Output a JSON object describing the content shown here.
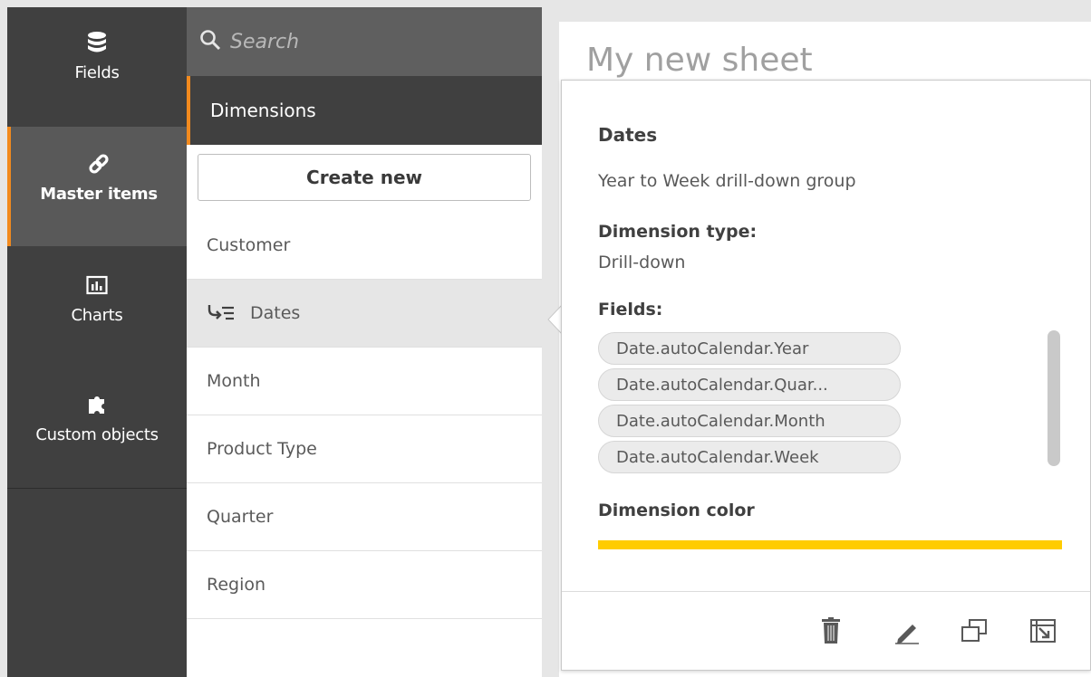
{
  "nav": {
    "items": [
      {
        "label": "Fields",
        "icon": "database-icon"
      },
      {
        "label": "Master items",
        "icon": "link-icon"
      },
      {
        "label": "Charts",
        "icon": "bar-chart-icon"
      },
      {
        "label": "Custom objects",
        "icon": "puzzle-icon"
      }
    ]
  },
  "search": {
    "placeholder": "Search"
  },
  "section": {
    "title": "Dimensions"
  },
  "create_button": "Create new",
  "dimensions": [
    {
      "label": "Customer"
    },
    {
      "label": "Dates",
      "drilldown": true,
      "selected": true
    },
    {
      "label": "Month"
    },
    {
      "label": "Product Type"
    },
    {
      "label": "Quarter"
    },
    {
      "label": "Region"
    }
  ],
  "sheet": {
    "title": "My new sheet"
  },
  "popover": {
    "title": "Dates",
    "description": "Year to Week drill-down group",
    "type_label": "Dimension type:",
    "type_value": "Drill-down",
    "fields_label": "Fields:",
    "fields": [
      "Date.autoCalendar.Year",
      "Date.autoCalendar.Quar...",
      "Date.autoCalendar.Month",
      "Date.autoCalendar.Week"
    ],
    "color_label": "Dimension color",
    "color": "#ffcc00",
    "actions": [
      "delete-icon",
      "edit-icon",
      "duplicate-icon",
      "add-to-sheet-icon"
    ]
  },
  "colors": {
    "accent": "#f28a1e",
    "nav_bg": "#404040",
    "nav_selected": "#595959"
  }
}
